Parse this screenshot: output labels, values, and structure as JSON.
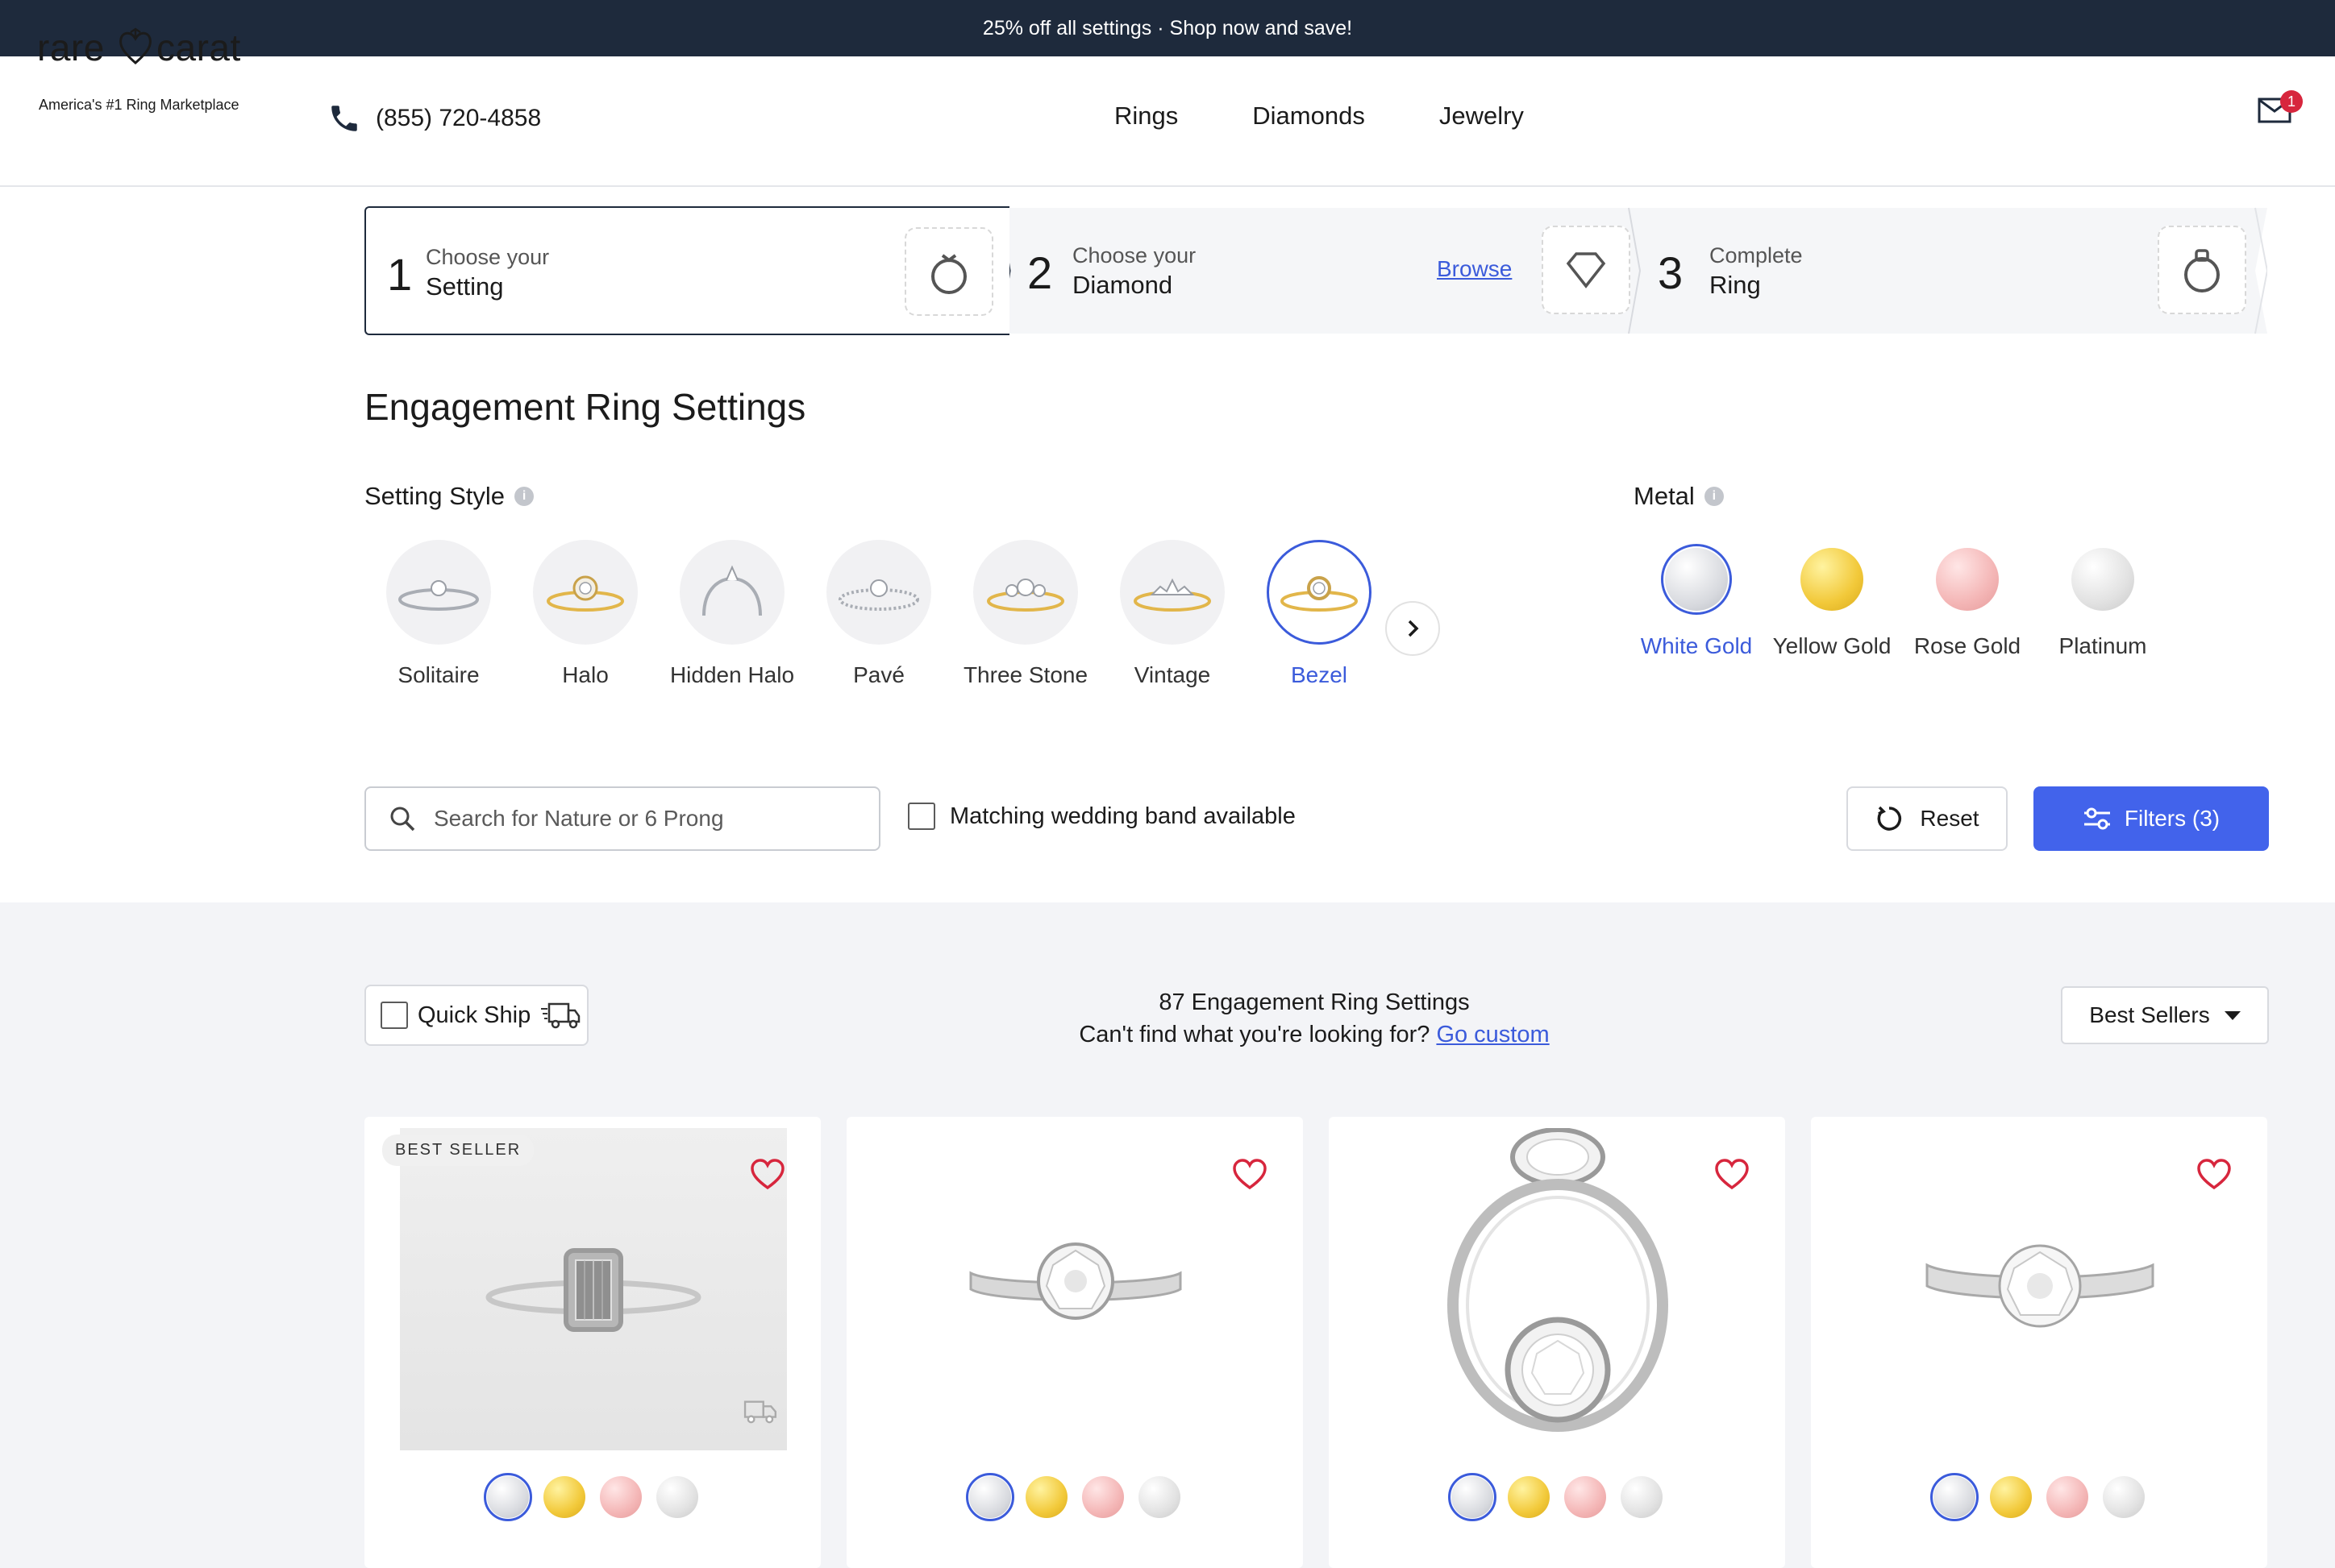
{
  "promo": {
    "text": "25% off all settings · Shop now and save!"
  },
  "header": {
    "logo_left": "rare",
    "logo_right": "carat",
    "tagline": "America's #1 Ring Marketplace",
    "phone": "(855) 720-4858",
    "nav": [
      "Rings",
      "Diamonds",
      "Jewelry"
    ],
    "mail_badge": "1"
  },
  "steps": [
    {
      "num": "1",
      "line1": "Choose your",
      "line2": "Setting",
      "icon": "ring-icon"
    },
    {
      "num": "2",
      "line1": "Choose your",
      "line2": "Diamond",
      "link": "Browse",
      "icon": "diamond-icon"
    },
    {
      "num": "3",
      "line1": "Complete",
      "line2": "Ring",
      "icon": "ring-icon"
    }
  ],
  "page_title": "Engagement Ring Settings",
  "setting_style": {
    "label": "Setting Style",
    "items": [
      "Solitaire",
      "Halo",
      "Hidden Halo",
      "Pavé",
      "Three Stone",
      "Vintage",
      "Bezel"
    ],
    "active": "Bezel"
  },
  "metal": {
    "label": "Metal",
    "items": [
      "White Gold",
      "Yellow Gold",
      "Rose Gold",
      "Platinum"
    ],
    "active": "White Gold"
  },
  "search": {
    "placeholder": "Search for Nature or 6 Prong"
  },
  "band_checkbox": {
    "label": "Matching wedding band available",
    "checked": false
  },
  "reset_label": "Reset",
  "filters_label": "Filters (3)",
  "quickship": {
    "label": "Quick Ship",
    "checked": false
  },
  "results": {
    "count_text": "87 Engagement Ring Settings",
    "custom_prompt": "Can't find what you're looking for?",
    "custom_link": "Go custom"
  },
  "sort": {
    "selected": "Best Sellers"
  },
  "products": [
    {
      "badge": "BEST SELLER",
      "favorited": false,
      "quick_ship": true,
      "selected_metal": "White Gold"
    },
    {
      "badge": "",
      "favorited": false,
      "quick_ship": false,
      "selected_metal": "White Gold"
    },
    {
      "badge": "",
      "favorited": false,
      "quick_ship": false,
      "selected_metal": "White Gold"
    },
    {
      "badge": "",
      "favorited": false,
      "quick_ship": false,
      "selected_metal": "White Gold"
    }
  ],
  "colors": {
    "promo_bg": "#1e2a3c",
    "accent_blue": "#4263eb",
    "heart_red": "#d7263d"
  }
}
